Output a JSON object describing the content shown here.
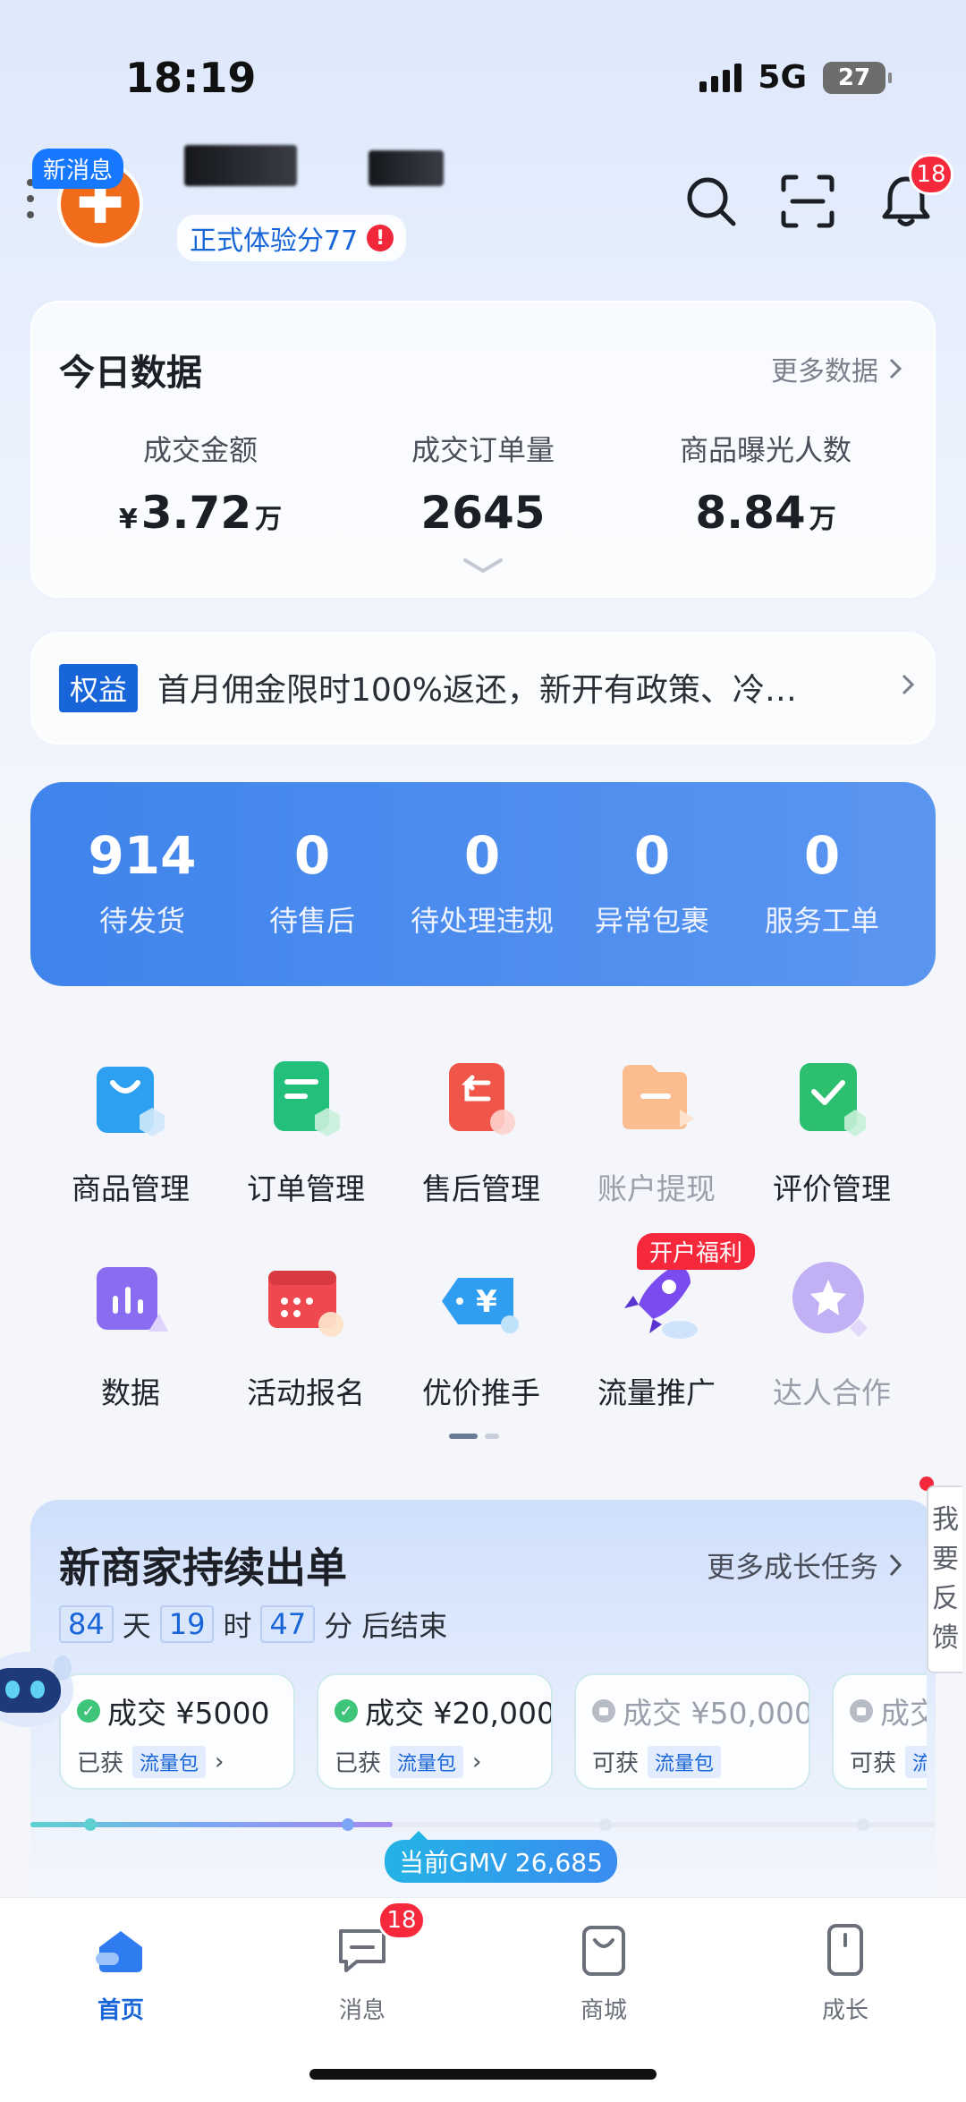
{
  "status_bar": {
    "time": "18:19",
    "network": "5G",
    "battery": "27"
  },
  "header": {
    "new_message_badge": "新消息",
    "experience_score": "正式体验分77",
    "score_warning": "!",
    "bell_badge": "18"
  },
  "today_data": {
    "title": "今日数据",
    "more_label": "更多数据",
    "stats": [
      {
        "label": "成交金额",
        "prefix": "¥",
        "value": "3.72",
        "unit": "万"
      },
      {
        "label": "成交订单量",
        "prefix": "",
        "value": "2645",
        "unit": ""
      },
      {
        "label": "商品曝光人数",
        "prefix": "",
        "value": "8.84",
        "unit": "万"
      }
    ]
  },
  "promo": {
    "tag": "权益",
    "text": "首月佣金限时100%返还，新开有政策、冷…"
  },
  "pending": [
    {
      "count": "914",
      "label": "待发货"
    },
    {
      "count": "0",
      "label": "待售后"
    },
    {
      "count": "0",
      "label": "待处理违规"
    },
    {
      "count": "0",
      "label": "异常包裹"
    },
    {
      "count": "0",
      "label": "服务工单"
    }
  ],
  "tools": [
    {
      "label": "商品管理",
      "icon": "shopping-bag-icon"
    },
    {
      "label": "订单管理",
      "icon": "order-doc-icon"
    },
    {
      "label": "售后管理",
      "icon": "return-icon"
    },
    {
      "label": "账户提现",
      "icon": "wallet-icon"
    },
    {
      "label": "评价管理",
      "icon": "review-check-icon"
    },
    {
      "label": "数据",
      "icon": "bar-chart-icon"
    },
    {
      "label": "活动报名",
      "icon": "calendar-icon"
    },
    {
      "label": "优价推手",
      "icon": "yuan-tag-icon"
    },
    {
      "label": "流量推广",
      "icon": "rocket-icon"
    },
    {
      "label": "达人合作",
      "icon": "star-badge-icon"
    }
  ],
  "tool_badge": "开户福利",
  "growth": {
    "title": "新商家持续出单",
    "more_label": "更多成长任务",
    "countdown": {
      "days": "84",
      "days_unit": "天",
      "hours": "19",
      "hours_unit": "时",
      "minutes": "47",
      "minutes_unit": "分",
      "suffix": "后结束"
    },
    "milestones": [
      {
        "title": "成交 ¥5000",
        "status": "已获",
        "reward": "流量包"
      },
      {
        "title": "成交 ¥20,000",
        "status": "已获",
        "reward": "流量包"
      },
      {
        "title": "成交 ¥50,000",
        "status": "可获",
        "reward": "流量包"
      },
      {
        "title": "成交",
        "status": "可获",
        "reward": "流量包"
      }
    ],
    "current_gmv": "当前GMV 26,685",
    "progress": 0.4
  },
  "feedback": "我要反馈",
  "tabbar": {
    "tabs": [
      {
        "label": "首页",
        "icon": "home-icon"
      },
      {
        "label": "消息",
        "icon": "chat-icon"
      },
      {
        "label": "商城",
        "icon": "shop-bag-icon"
      },
      {
        "label": "成长",
        "icon": "growth-icon"
      }
    ],
    "message_badge": "18"
  },
  "colors": {
    "accent": "#1765d8",
    "pending_bg": "#4a8aee",
    "badge_red": "#f5283c"
  }
}
